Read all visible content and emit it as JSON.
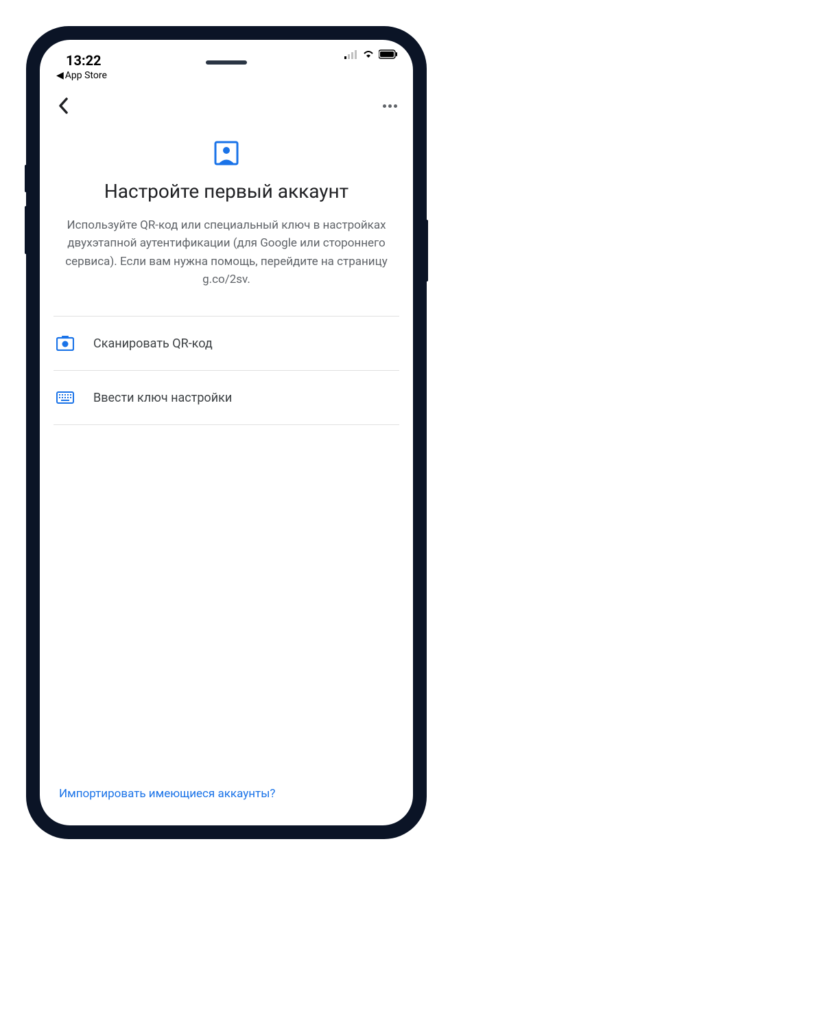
{
  "status": {
    "time": "13:22",
    "back_app_label": "App Store"
  },
  "page": {
    "title": "Настройте первый аккаунт",
    "description": "Используйте QR-код или специальный ключ в настройках двухэтапной аутентификации (для Google или стороннего сервиса). Если вам нужна помощь, перейдите на страницу g.co/2sv."
  },
  "options": {
    "scan_qr": "Сканировать QR-код",
    "enter_key": "Ввести ключ настройки"
  },
  "footer": {
    "import_link": "Импортировать имеющиеся аккаунты?"
  },
  "colors": {
    "accent": "#1a73e8",
    "text_primary": "#202124",
    "text_secondary": "#5f6368"
  }
}
